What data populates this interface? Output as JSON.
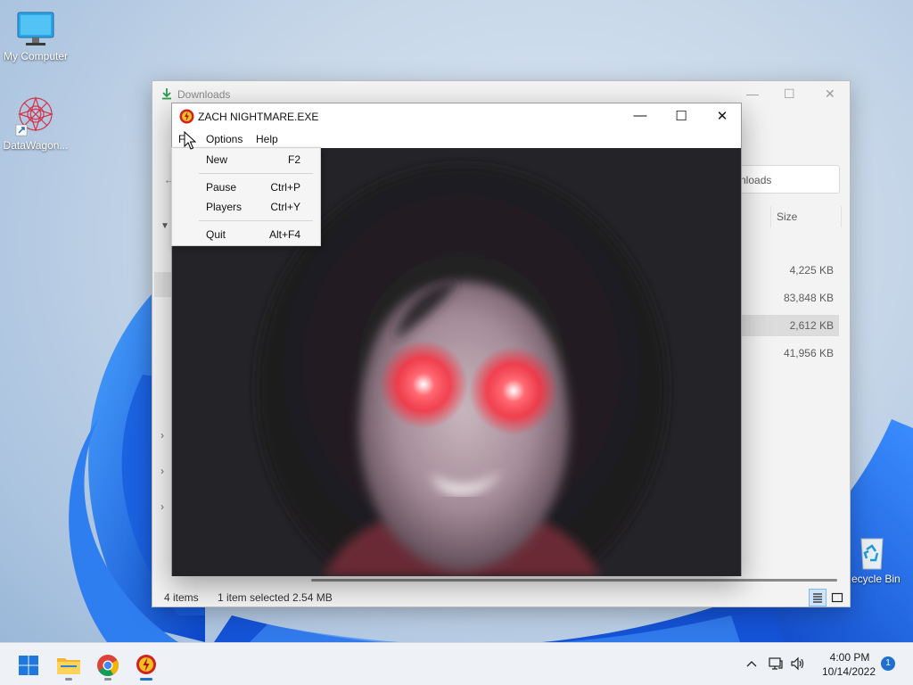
{
  "desktop": {
    "icons": [
      {
        "label": "My Computer",
        "icon": "monitor-icon"
      },
      {
        "label": "DataWagon...",
        "icon": "datawagon-shortcut-icon"
      },
      {
        "label": "Recycle Bin",
        "icon": "recycle-bin-icon"
      }
    ]
  },
  "explorer": {
    "title": "Downloads",
    "search_placeholder": "Search Downloads",
    "search_visible": "nloads",
    "column_size": "Size",
    "sizes": [
      "4,225 KB",
      "83,848 KB",
      "2,612 KB",
      "41,956 KB"
    ],
    "status_items": "4 items",
    "status_selected": "1 item selected  2.54 MB"
  },
  "game": {
    "title": "ZACH NIGHTMARE.EXE",
    "menu": {
      "file_visible": "Fi",
      "file": "File",
      "options": "Options",
      "help": "Help"
    },
    "file_menu": [
      {
        "label": "New",
        "shortcut": "F2"
      },
      {
        "label": "Pause",
        "shortcut": "Ctrl+P"
      },
      {
        "label": "Players",
        "shortcut": "Ctrl+Y"
      },
      {
        "label": "Quit",
        "shortcut": "Alt+F4"
      }
    ],
    "window_controls": {
      "minimize": "—",
      "maximize": "☐",
      "close": "✕"
    }
  },
  "taskbar": {
    "apps": [
      "start-icon",
      "file-explorer-icon",
      "chrome-icon",
      "zach-nightmare-icon"
    ],
    "time": "4:00 PM",
    "date": "10/14/2022",
    "notifications": "1"
  },
  "colors": {
    "accent": "#1f6fd1",
    "eye_glow": "#ff2a3a"
  }
}
